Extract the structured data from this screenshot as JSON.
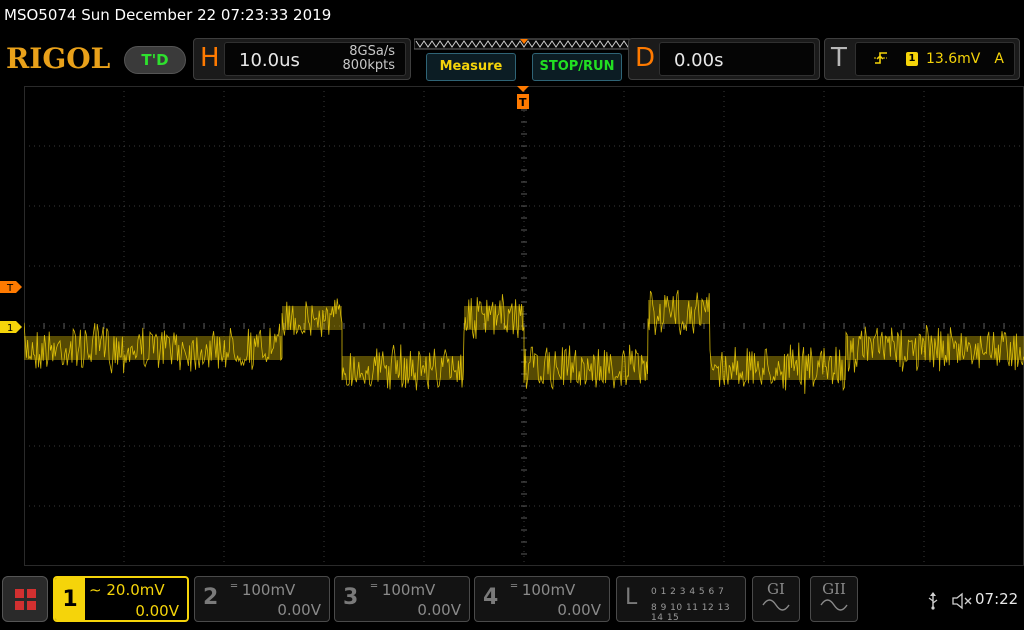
{
  "title_bar": {
    "text": "MSO5074  Sun December 22 07:23:33 2019"
  },
  "brand": {
    "logo": "RIGOL",
    "td_button": "T'D"
  },
  "horizontal": {
    "letter": "H",
    "timebase": "10.0us",
    "sample_rate": "8GSa/s",
    "memory_depth": "800kpts"
  },
  "buttons": {
    "measure": "Measure",
    "stop_run": "STOP/RUN"
  },
  "delay": {
    "letter": "D",
    "value": "0.00s"
  },
  "trigger": {
    "letter": "T",
    "icon": "rising-edge-icon",
    "source": "1",
    "level": "13.6mV",
    "mode": "A"
  },
  "markers": {
    "trigger_level_label": "T",
    "channel1_label": "1",
    "trigger_position_label": "T"
  },
  "channels": [
    {
      "number": "1",
      "coupling_icon": "ac-coupling-icon",
      "scale": "20.0mV",
      "offset": "0.00V",
      "active": true,
      "color": "#f5d40a"
    },
    {
      "number": "2",
      "coupling_icon": "dc-coupling-icon",
      "scale": "100mV",
      "offset": "0.00V",
      "active": false
    },
    {
      "number": "3",
      "coupling_icon": "dc-coupling-icon",
      "scale": "100mV",
      "offset": "0.00V",
      "active": false
    },
    {
      "number": "4",
      "coupling_icon": "dc-coupling-icon",
      "scale": "100mV",
      "offset": "0.00V",
      "active": false
    }
  ],
  "logic": {
    "letter": "L",
    "row1": "0 1 2 3   4 5 6 7",
    "row2": "8 9 10 11  12 13 14 15"
  },
  "generators": [
    {
      "label": "GI"
    },
    {
      "label": "GII"
    }
  ],
  "status": {
    "usb_icon": "usb-icon",
    "mute_icon": "speaker-muted-icon",
    "time": "07:22"
  },
  "colors": {
    "channel1": "#f5d40a",
    "orange": "#ff7a00",
    "grid": "#3a3a3a"
  }
}
